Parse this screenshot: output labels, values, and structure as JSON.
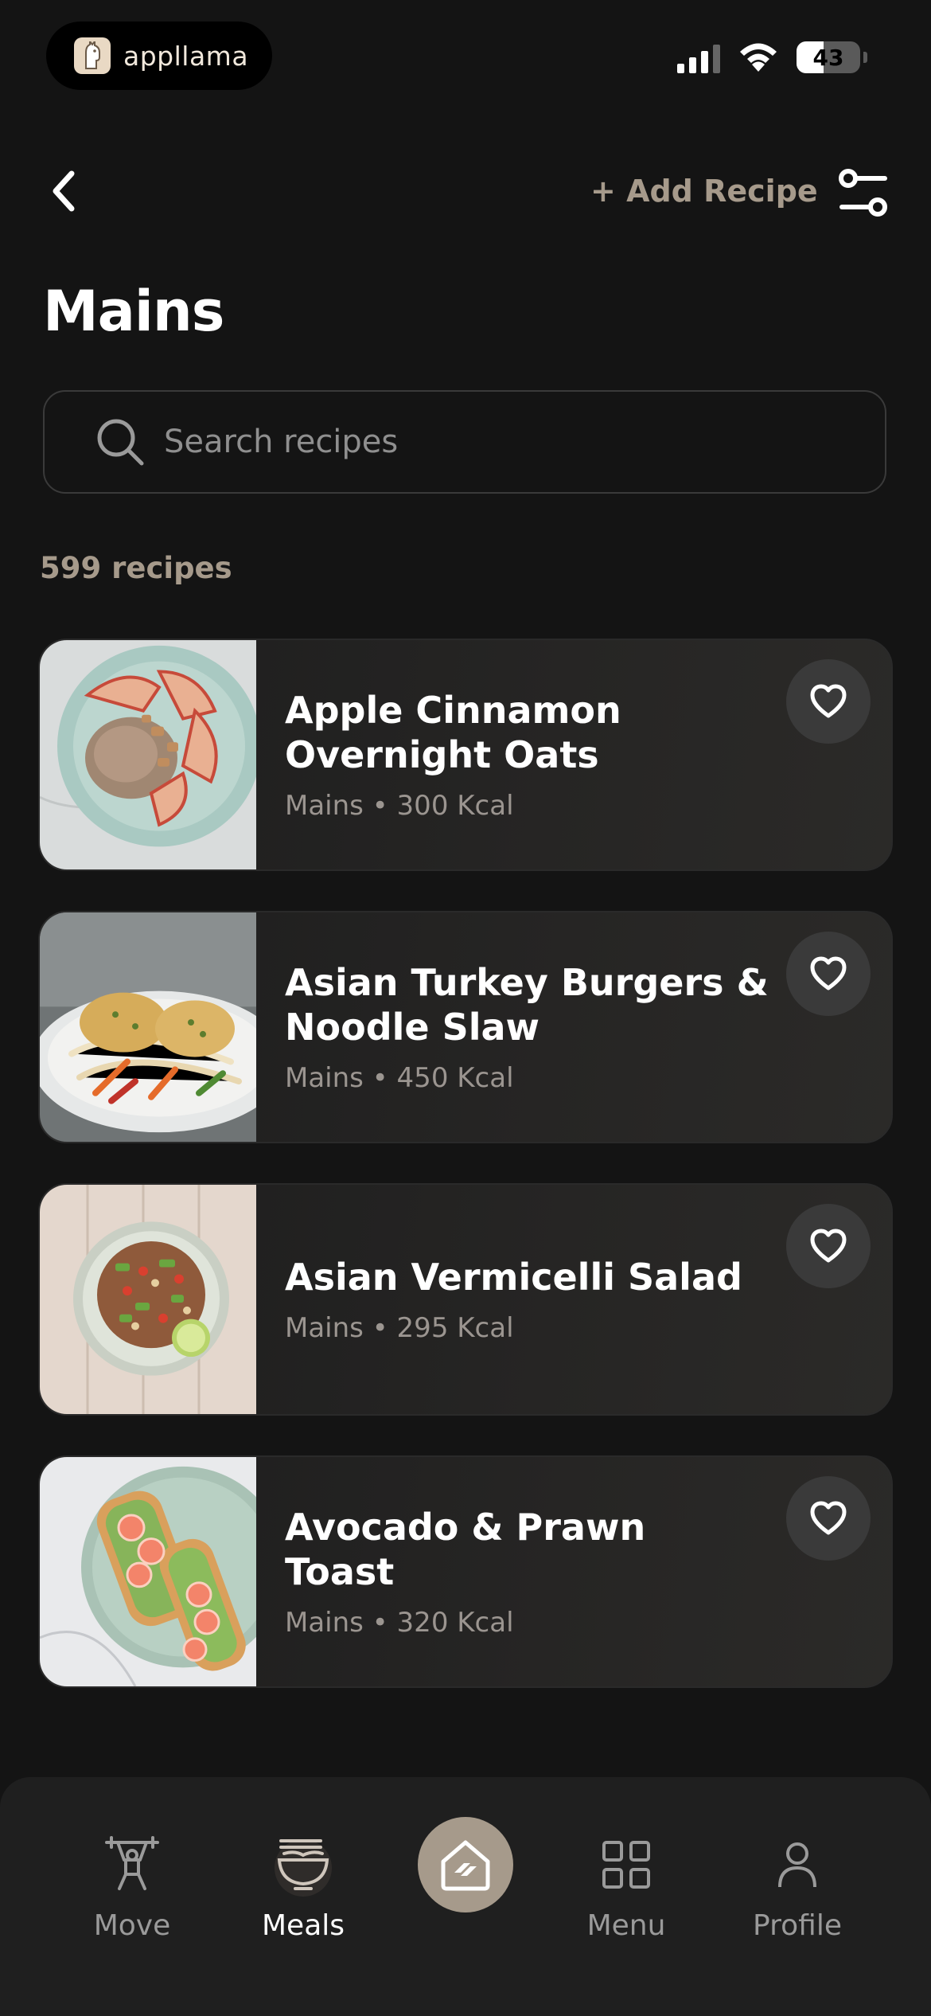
{
  "status_bar": {
    "brand_name": "appllama",
    "battery": "43",
    "battery_level": 0.43
  },
  "header": {
    "add_recipe_label": "+ Add Recipe",
    "title": "Mains"
  },
  "search": {
    "placeholder": "Search recipes"
  },
  "recipe_count": "599 recipes",
  "recipes": [
    {
      "title_line1": "Apple Cinnamon",
      "title_line2": "Overnight Oats",
      "meta": "Mains • 300 Kcal"
    },
    {
      "title_line1": "Asian Turkey Burgers &",
      "title_line2": "Noodle Slaw",
      "meta": "Mains • 450 Kcal"
    },
    {
      "title_line1": "Asian Vermicelli Salad",
      "title_line2": "",
      "meta": "Mains • 295 Kcal"
    },
    {
      "title_line1": "Avocado & Prawn",
      "title_line2": "Toast",
      "meta": "Mains • 320 Kcal"
    }
  ],
  "nav": {
    "items": [
      {
        "label": "Move",
        "icon": "weightlifter-icon"
      },
      {
        "label": "Meals",
        "icon": "noodle-bowl-icon",
        "active": true
      },
      {
        "label": "",
        "icon": "home-icon"
      },
      {
        "label": "Menu",
        "icon": "grid-icon"
      },
      {
        "label": "Profile",
        "icon": "person-icon"
      }
    ]
  },
  "colors": {
    "background": "#141414",
    "accent": "#a69a8b",
    "card": "#232322",
    "nav": "#1f1f1f"
  }
}
